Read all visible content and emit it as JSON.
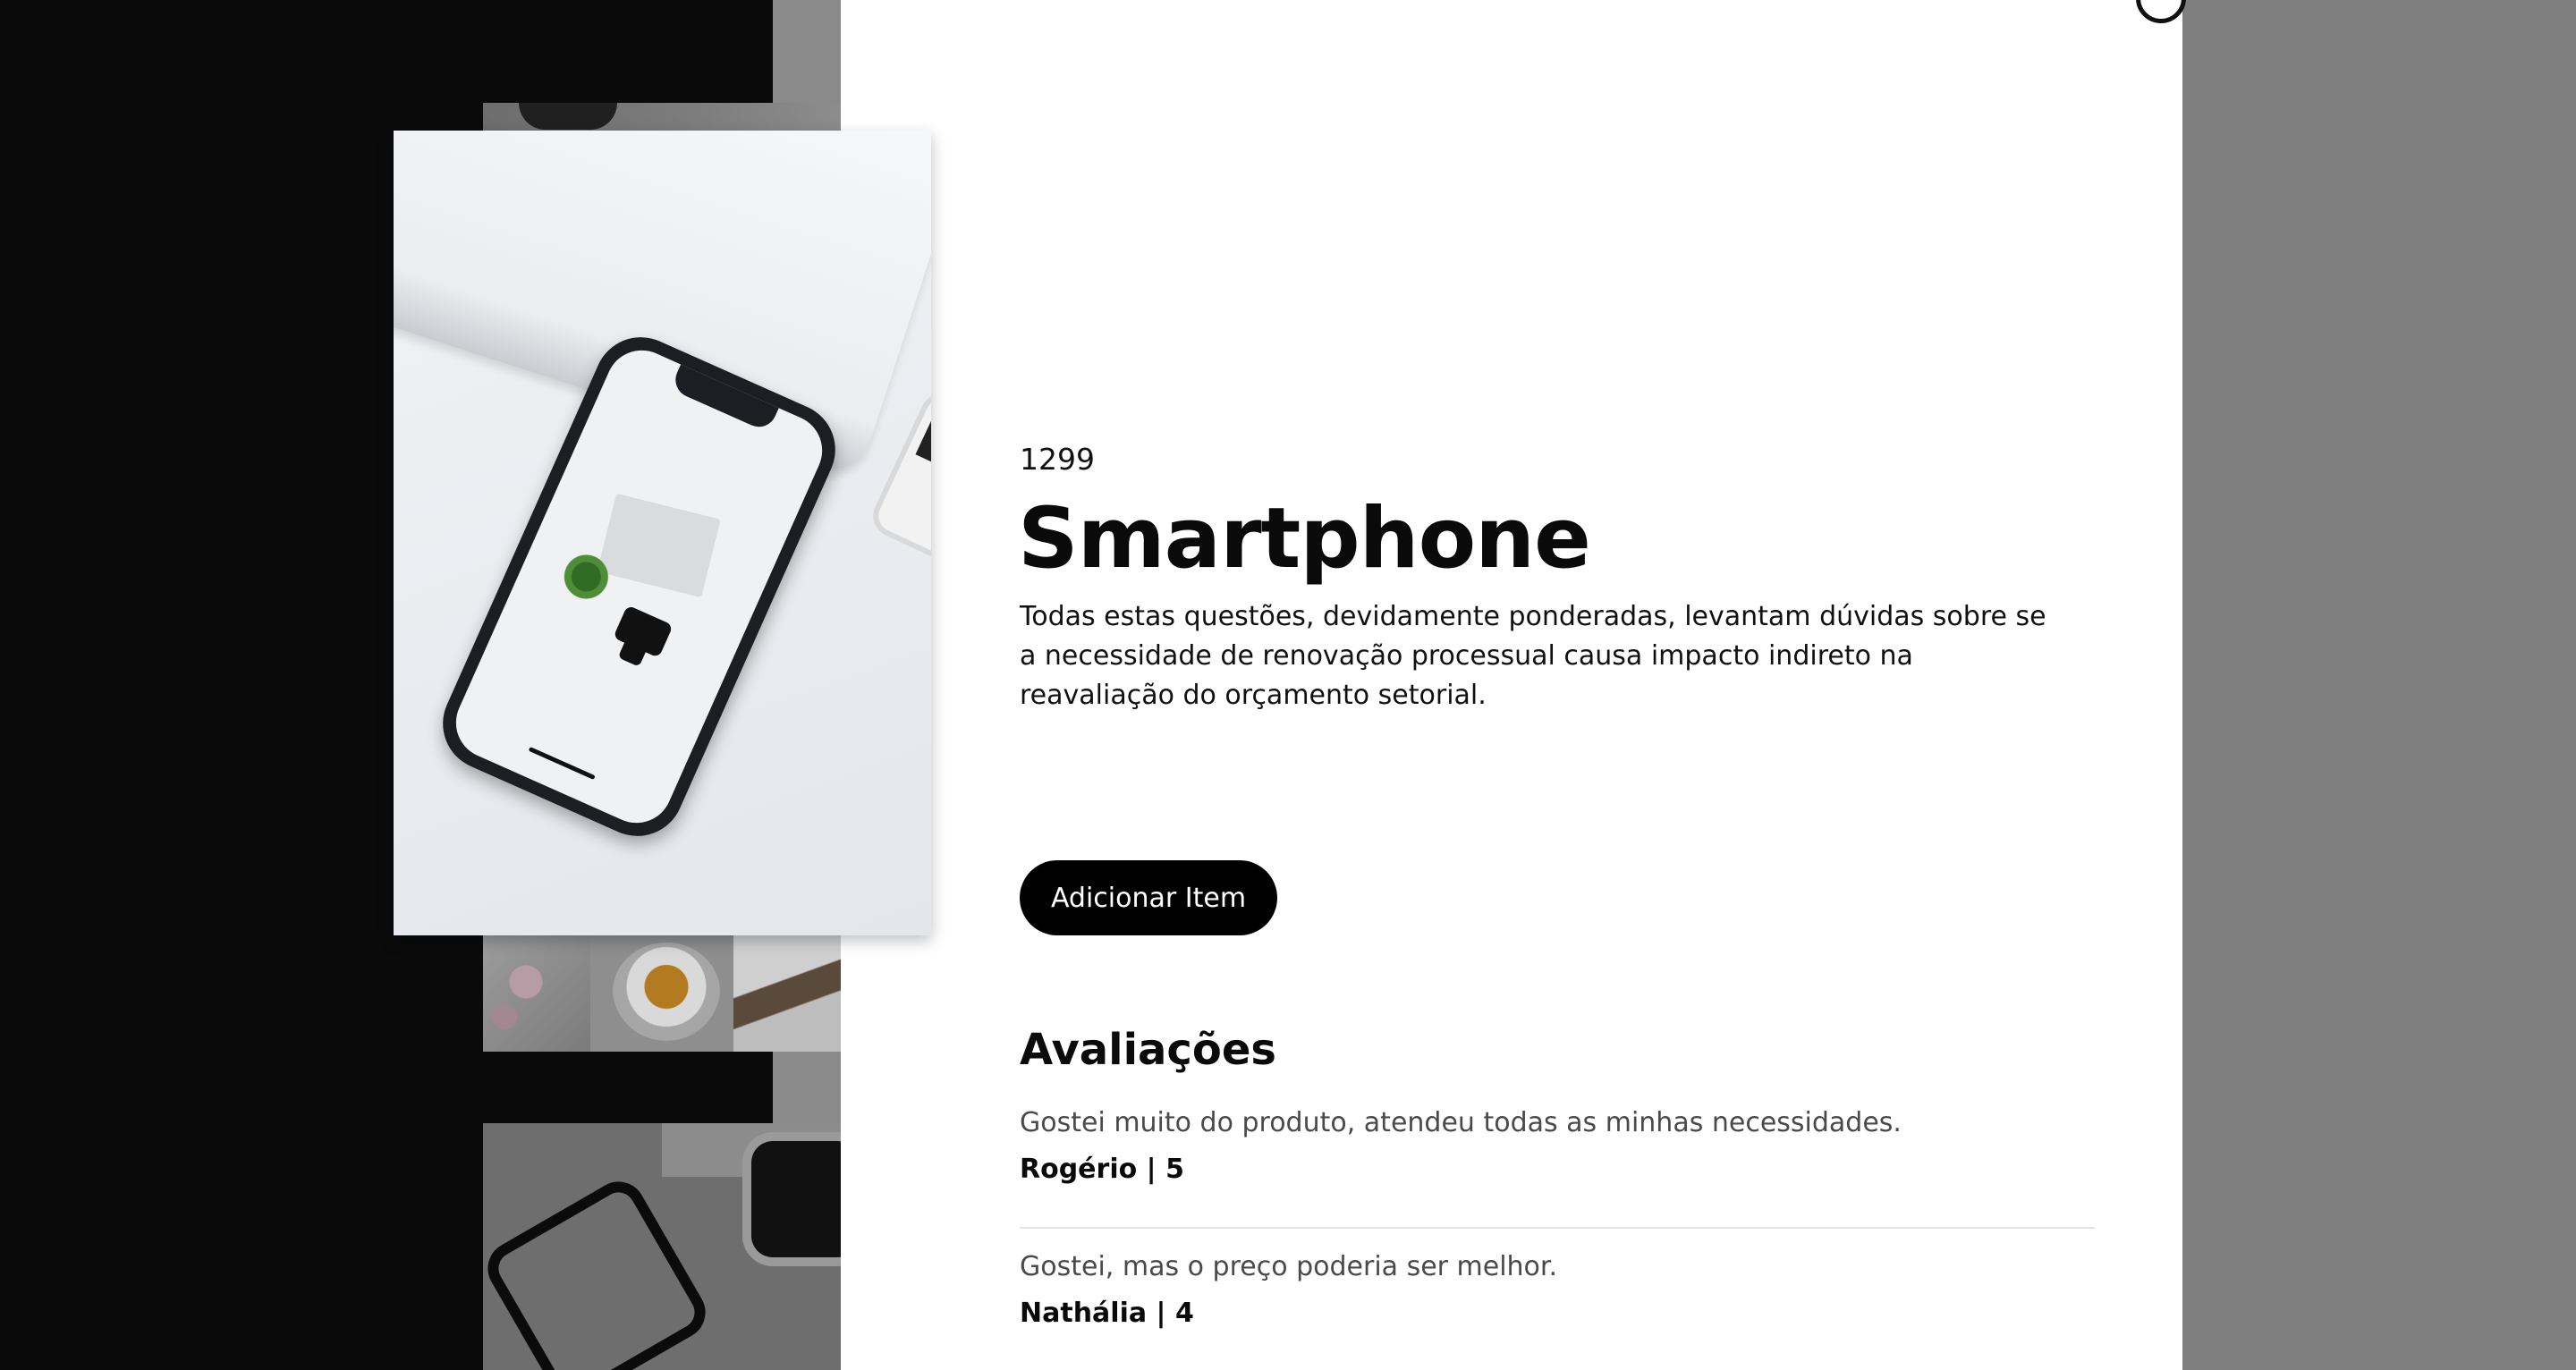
{
  "product": {
    "price": "1299",
    "name": "Smartphone",
    "description": "Todas estas questões, devidamente ponderadas, levantam dúvidas sobre se a necessidade de renovação processual causa impacto indireto na reavaliação do orçamento setorial.",
    "image_alt": "Smartphone",
    "add_button_label": "Adicionar Item"
  },
  "reviews": {
    "heading": "Avaliações",
    "items": [
      {
        "text": "Gostei muito do produto, atendeu todas as minhas necessidades.",
        "author": "Rogério | 5"
      },
      {
        "text": "Gostei, mas o preço poderia ser melhor.",
        "author": "Nathália | 4"
      }
    ]
  },
  "colors": {
    "overlay": "#7f7f7f",
    "modal_background": "#ffffff",
    "button_background": "#000000",
    "button_text": "#ffffff"
  },
  "icons": {
    "close": "close-icon"
  }
}
